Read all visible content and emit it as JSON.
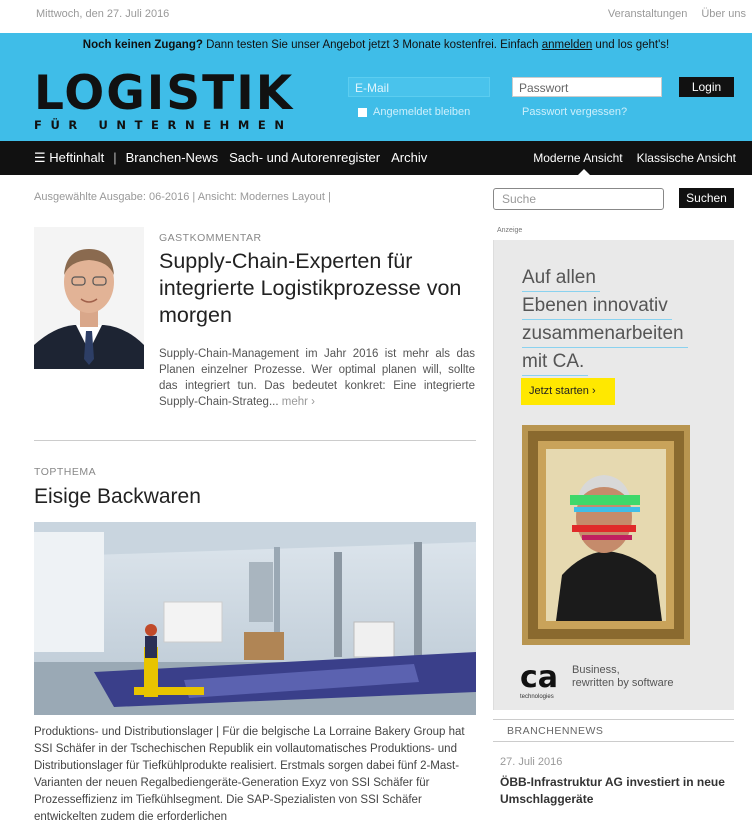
{
  "topbar": {
    "date": "Mittwoch, den 27. Juli 2016",
    "links": [
      "Veranstaltungen",
      "Über uns"
    ]
  },
  "promo": {
    "lead": "Noch keinen Zugang?",
    "text_before": " Dann testen Sie unser Angebot jetzt 3 Monate kostenfrei. Einfach ",
    "link": "anmelden",
    "text_after": " und los geht's!"
  },
  "logo": {
    "main": "LOGISTIK",
    "sub": "FÜR UNTERNEHMEN"
  },
  "login": {
    "email_placeholder": "E-Mail",
    "password_placeholder": "Passwort",
    "login_label": "Login",
    "remember_label": "Angemeldet bleiben",
    "forgot_label": "Passwort vergessen?"
  },
  "nav": {
    "items": [
      "☰ Heftinhalt",
      "Branchen-News",
      "Sach- und Autorenregister",
      "Archiv"
    ],
    "views": [
      "Moderne Ansicht",
      "Klassische Ansicht"
    ]
  },
  "issue_line": "Ausgewählte Ausgabe: 06-2016  |  Ansicht: Modernes Layout  |",
  "search": {
    "placeholder": "Suche",
    "button": "Suchen"
  },
  "article1": {
    "kicker": "GASTKOMMENTAR",
    "title": "Supply-Chain-Experten für integrierte Logistikprozesse von morgen",
    "text": "Supply-Chain-Management im Jahr 2016 ist mehr als das Planen einzelner Prozesse. Wer optimal planen will, sollte das integriert tun. Das bedeutet konkret: Eine integrierte Supply-Chain-Strateg...",
    "more": "mehr ›"
  },
  "article2": {
    "kicker": "TOPTHEMA",
    "title": "Eisige Backwaren",
    "text": "Produktions- und Distributionslager | Für die belgische La Lorraine Bakery Group hat SSI Schäfer in der Tschechischen Republik ein vollautomatisches Produktions- und Distributionslager für Tiefkühlprodukte realisiert. Erstmals sorgen dabei fünf 2-Mast-Varianten der neuen Regalbediengeräte-Generation Exyz von SSI Schäfer für Prozesseffizienz im Tiefkühlsegment. Die SAP-Spezialisten von SSI Schäfer entwickelten zudem die erforderlichen"
  },
  "ad": {
    "label": "Anzeige",
    "headline": [
      "Auf allen",
      "Ebenen innovativ",
      "zusammenarbeiten",
      "mit CA."
    ],
    "cta": "Jetzt starten ›",
    "logo_text": "ca",
    "logo_sub": "technologies",
    "tagline": [
      "Business,",
      "rewritten by software"
    ]
  },
  "branchennews": {
    "heading": "BRANCHENNEWS",
    "date": "27. Juli 2016",
    "title": "ÖBB-Infrastruktur AG investiert in neue Umschlaggeräte"
  },
  "colors": {
    "header_blue": "#3fbde8",
    "nav_black": "#111111",
    "cta_yellow": "#ffe800"
  }
}
